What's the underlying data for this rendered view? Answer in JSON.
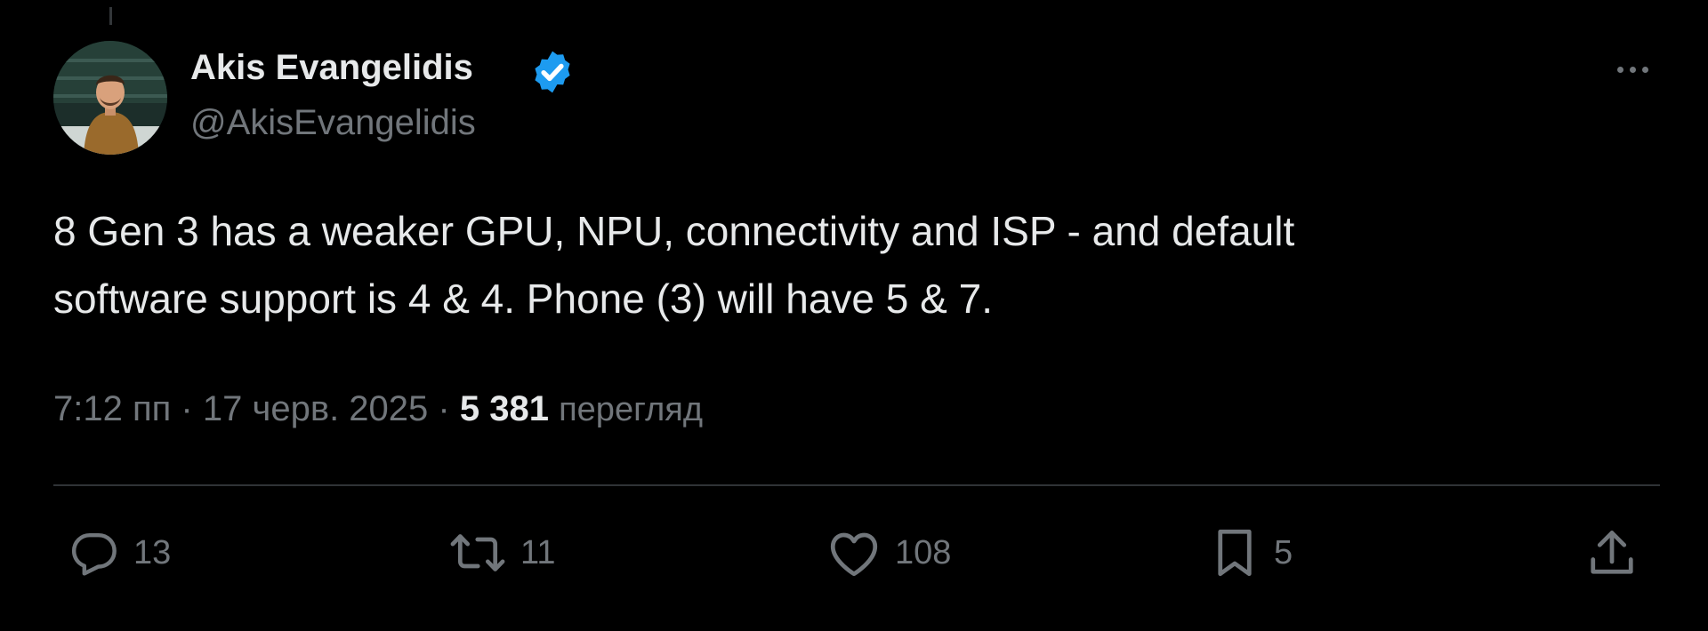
{
  "author": {
    "display_name": "Akis Evangelidis",
    "handle": "@AkisEvangelidis",
    "verified": true
  },
  "tweet": {
    "text_lines": [
      "8 Gen 3 has a weaker GPU, NPU, connectivity and ISP - and default",
      "software support is 4 & 4. Phone (3) will have 5 & 7."
    ]
  },
  "meta": {
    "time": "7:12 пп",
    "separator": "·",
    "date": "17 черв. 2025",
    "views_count": "5 381",
    "views_label": "перегляд"
  },
  "actions": {
    "replies": "13",
    "reposts": "11",
    "likes": "108",
    "bookmarks": "5"
  },
  "colors": {
    "background": "#000000",
    "text_primary": "#e7e9ea",
    "text_secondary": "#71767b",
    "verified_blue": "#1d9bf0",
    "divider": "#2f3336"
  },
  "icons": {
    "more": "more-horizontal-icon",
    "verified": "verified-badge-icon",
    "reply": "reply-icon",
    "repost": "repost-icon",
    "like": "heart-icon",
    "bookmark": "bookmark-icon",
    "share": "share-icon"
  }
}
